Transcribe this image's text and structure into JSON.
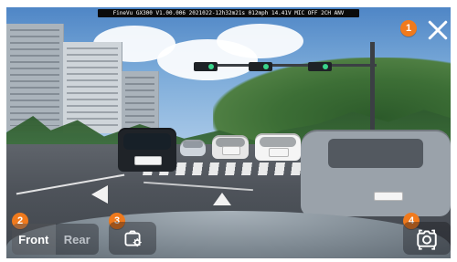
{
  "hud": {
    "status_text": "FineVu GX300 V1.00.006 2021022-12h32m21s 012mph 14.41V MIC OFF 2CH ANV"
  },
  "callouts": {
    "close": "1",
    "front_rear": "2",
    "settings": "3",
    "capture": "4"
  },
  "controls": {
    "front_label": "Front",
    "rear_label": "Rear"
  },
  "icons": {
    "close": "close-icon",
    "settings": "camera-settings-icon",
    "capture": "camera-icon"
  },
  "colors": {
    "badge": "#f07a1d"
  }
}
